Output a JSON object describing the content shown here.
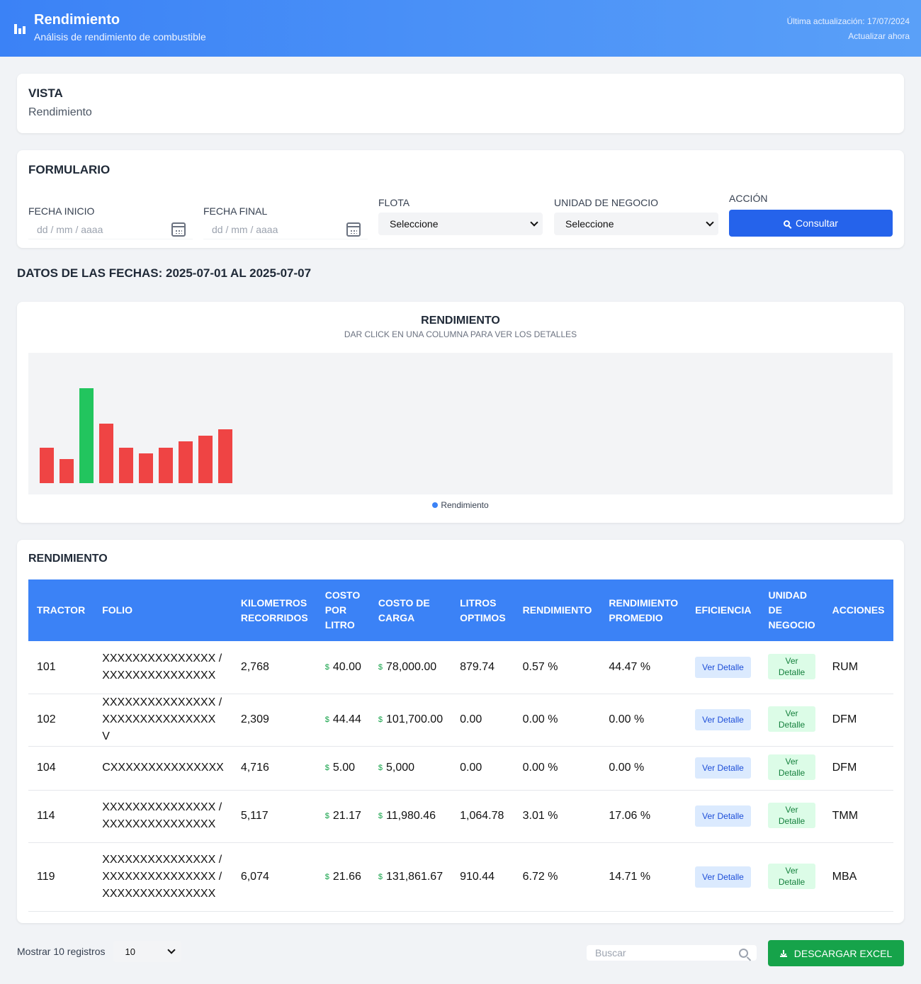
{
  "header": {
    "title": "Rendimiento",
    "subtitle": "Análisis de rendimiento de combustible",
    "last_update": "Última actualización: 17/07/2024",
    "refresh_label": "Actualizar ahora",
    "icon": "bar-chart-icon"
  },
  "vista": {
    "title": "VISTA",
    "value": "Rendimiento"
  },
  "form": {
    "title": "FORMULARIO",
    "fecha_inicio": {
      "label": "FECHA INICIO",
      "placeholder": "dd / mm / aaaa"
    },
    "fecha_final": {
      "label": "FECHA FINAL",
      "placeholder": "dd / mm / aaaa"
    },
    "flota": {
      "label": "FLOTA",
      "value": "Seleccione"
    },
    "unidad": {
      "label": "UNIDAD DE NEGOCIO",
      "value": "Seleccione"
    },
    "accion": {
      "label": "ACCIÓN",
      "button": "Consultar"
    }
  },
  "dates_title": "DATOS DE LAS FECHAS: 2025-07-01 AL 2025-07-07",
  "chart": {
    "title": "RENDIMIENTO",
    "subtitle": "DAR CLICK EN UNA COLUMNA PARA VER LOS DETALLES",
    "legend": "Rendimiento"
  },
  "chart_data": {
    "type": "bar",
    "title": "RENDIMIENTO",
    "legend": [
      "Rendimiento"
    ],
    "legend_position": "bottom",
    "series": [
      {
        "name": "Rendimiento",
        "values": [
          50,
          34,
          134,
          84,
          50,
          42,
          50,
          59,
          67,
          76
        ]
      }
    ],
    "bar_colors": [
      "#ef4444",
      "#ef4444",
      "#22c55e",
      "#ef4444",
      "#ef4444",
      "#ef4444",
      "#ef4444",
      "#ef4444",
      "#ef4444",
      "#ef4444"
    ],
    "ylim": [
      0,
      200
    ],
    "grid": false
  },
  "table": {
    "title": "RENDIMIENTO",
    "headers": {
      "tractor": "TRACTOR",
      "folio": "FOLIO",
      "km": "KILOMETROS RECORRIDOS",
      "costo_litro": "COSTO POR LITRO",
      "costo_carga": "COSTO DE CARGA",
      "litros": "LITROS OPTIMOS",
      "rendimiento": "RENDIMIENTO",
      "rend_prom": "RENDIMIENTO PROMEDIO",
      "eficiencia": "EFICIENCIA",
      "unidad": "UNIDAD DE NEGOCIO",
      "acciones": "ACCIONES"
    },
    "currency": "$",
    "eficiencia_label": "Ver Detalle",
    "unidad_label": "Ver Detalle",
    "rows": [
      {
        "tractor": "101",
        "folio": "XXXXXXXXXXXXXXX / XXXXXXXXXXXXXXX",
        "km": "2,768",
        "costo_litro": "40.00",
        "costo_carga": "78,000.00",
        "litros": "879.74",
        "rendimiento": "0.57 %",
        "rend_prom": "44.47 %",
        "acciones": "RUM"
      },
      {
        "tractor": "102",
        "folio": "XXXXXXXXXXXXXXX / XXXXXXXXXXXXXXX V",
        "km": "2,309",
        "costo_litro": "44.44",
        "costo_carga": "101,700.00",
        "litros": "0.00",
        "rendimiento": "0.00 %",
        "rend_prom": "0.00 %",
        "acciones": "DFM"
      },
      {
        "tractor": "104",
        "folio": "CXXXXXXXXXXXXXXX",
        "km": "4,716",
        "costo_litro": "5.00",
        "costo_carga": "5,000",
        "litros": "0.00",
        "rendimiento": "0.00 %",
        "rend_prom": "0.00 %",
        "acciones": "DFM"
      },
      {
        "tractor": "114",
        "folio": "XXXXXXXXXXXXXXX / XXXXXXXXXXXXXXX",
        "km": "5,117",
        "costo_litro": "21.17",
        "costo_carga": "11,980.46",
        "litros": "1,064.78",
        "rendimiento": "3.01 %",
        "rend_prom": "17.06 %",
        "acciones": "TMM"
      },
      {
        "tractor": "119",
        "folio": "XXXXXXXXXXXXXXX / XXXXXXXXXXXXXXX / XXXXXXXXXXXXXXX",
        "km": "6,074",
        "costo_litro": "21.66",
        "costo_carga": "131,861.67",
        "litros": "910.44",
        "rendimiento": "6.72 %",
        "rend_prom": "14.71 %",
        "acciones": "MBA"
      }
    ]
  },
  "footer": {
    "show_label": "Mostrar 10 registros",
    "page_size": "10",
    "search_placeholder": "Buscar",
    "excel_button": "DESCARGAR EXCEL"
  },
  "colors": {
    "primary": "#3b82f6",
    "button": "#2563eb",
    "success": "#16a34a",
    "bar_low": "#ef4444",
    "bar_high": "#22c55e"
  }
}
